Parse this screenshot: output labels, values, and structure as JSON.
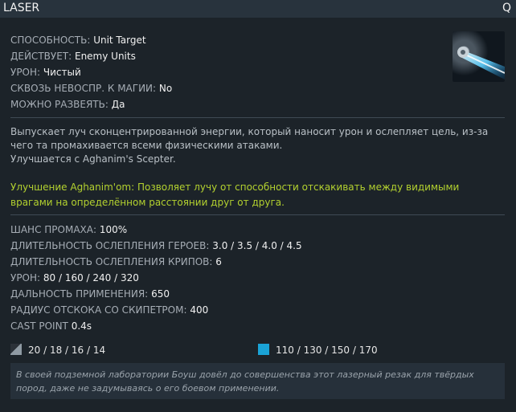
{
  "ability": {
    "name": "LASER",
    "hotkey": "Q",
    "icon": "laser-beam-icon"
  },
  "properties": [
    {
      "label": "СПОСОБНОСТЬ:",
      "value": "Unit Target"
    },
    {
      "label": "ДЕЙСТВУЕТ:",
      "value": "Enemy Units"
    },
    {
      "label": "УРОН:",
      "value": "Чистый"
    },
    {
      "label": "СКВОЗЬ НЕВОСПР. К МАГИИ:",
      "value": "No"
    },
    {
      "label": "МОЖНО РАЗВЕЯТЬ:",
      "value": "Да"
    }
  ],
  "description": {
    "text": "Выпускает луч сконцентрированной энергии, который наносит урон и ослепляет цель, из-за чего та промахивается всеми физическими атаками.",
    "upgrade_note": "Улучшается с Aghanim's Scepter."
  },
  "aghanim": {
    "text": "Улучшение Aghanim'om: Позволяет лучу от способности отскакивать между видимыми врагами на определённом расстоянии друг от друга."
  },
  "stats": [
    {
      "label": "ШАНС ПРОМАХА:",
      "value": "100%"
    },
    {
      "label": "ДЛИТЕЛЬНОСТЬ ОСЛЕПЛЕНИЯ ГЕРОЕВ:",
      "value": "3.0 / 3.5 / 4.0 / 4.5"
    },
    {
      "label": "ДЛИТЕЛЬНОСТЬ ОСЛЕПЛЕНИЯ КРИПОВ:",
      "value": "6"
    },
    {
      "label": "УРОН:",
      "value": "80 / 160 / 240 / 320"
    },
    {
      "label": "ДАЛЬНОСТЬ ПРИМЕНЕНИЯ:",
      "value": "650"
    },
    {
      "label": "РАДИУС ОТСКОКА СО СКИПЕТРОМ:",
      "value": "400"
    },
    {
      "label": "CAST POINT",
      "value": "0.4s"
    }
  ],
  "costs": {
    "cooldown": {
      "icon": "cooldown-icon",
      "value": "20 / 18 / 16 / 14"
    },
    "mana": {
      "icon": "mana-icon",
      "value": "110 / 130 / 150 / 170",
      "color": "#1aa3d6"
    }
  },
  "lore": "В своей подземной лаборатории Боуш довёл до совершенства этот лазерный резак для твёрдых пород, даже не задумываясь о его боевом применении."
}
